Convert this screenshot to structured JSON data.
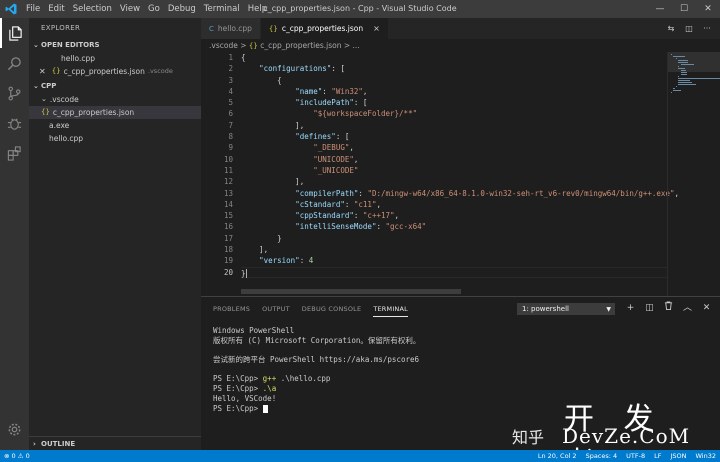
{
  "window": {
    "title": "c_cpp_properties.json - Cpp - Visual Studio Code",
    "menu": [
      "File",
      "Edit",
      "Selection",
      "View",
      "Go",
      "Debug",
      "Terminal",
      "Help"
    ],
    "controls": {
      "minimize": "—",
      "maximize": "☐",
      "close": "✕"
    }
  },
  "activity": {
    "icons": [
      "files-icon",
      "search-icon",
      "source-control-icon",
      "debug-icon",
      "extensions-icon"
    ],
    "settings_icon": "gear-icon"
  },
  "sidebar": {
    "title": "EXPLORER",
    "open_editors": {
      "label": "OPEN EDITORS",
      "items": [
        {
          "name": "hello.cpp",
          "dim": ""
        },
        {
          "name": "c_cpp_properties.json",
          "dim": ".vscode"
        }
      ]
    },
    "project": {
      "label": "CPP",
      "folder": ".vscode",
      "items": [
        {
          "name": "c_cpp_properties.json"
        },
        {
          "name": "a.exe"
        },
        {
          "name": "hello.cpp"
        }
      ]
    },
    "outline_label": "OUTLINE"
  },
  "tabs": [
    {
      "label": "hello.cpp",
      "active": false
    },
    {
      "label": "c_cpp_properties.json",
      "active": true,
      "close": "×"
    }
  ],
  "breadcrumb": {
    "folder": ".vscode",
    "sep": ">",
    "file": "c_cpp_properties.json",
    "tail": "> ..."
  },
  "editor": {
    "current_line": 20,
    "lines": [
      "{",
      "    \"configurations\": [",
      "        {",
      "            \"name\": \"Win32\",",
      "            \"includePath\": [",
      "                \"${workspaceFolder}/**\"",
      "            ],",
      "            \"defines\": [",
      "                \"_DEBUG\",",
      "                \"UNICODE\",",
      "                \"_UNICODE\"",
      "            ],",
      "            \"compilerPath\": \"D:/mingw-w64/x86_64-8.1.0-win32-seh-rt_v6-rev0/mingw64/bin/g++.exe\",",
      "            \"cStandard\": \"c11\",",
      "            \"cppStandard\": \"c++17\",",
      "            \"intelliSenseMode\": \"gcc-x64\"",
      "        }",
      "    ],",
      "    \"version\": 4",
      "}"
    ]
  },
  "panel": {
    "tabs": [
      "PROBLEMS",
      "OUTPUT",
      "DEBUG CONSOLE",
      "TERMINAL"
    ],
    "active_tab": "TERMINAL",
    "terminal_select": "1: powershell",
    "actions": {
      "add": "+",
      "split": "◫",
      "trash": "🗑",
      "maximize": "︿",
      "close": "✕"
    },
    "terminal_lines": [
      {
        "text": "Windows PowerShell"
      },
      {
        "text": "版权所有 (C) Microsoft Corporation。保留所有权利。"
      },
      {
        "text": ""
      },
      {
        "text": "尝试新的跨平台 PowerShell https://aka.ms/pscore6"
      },
      {
        "text": ""
      },
      {
        "prompt": "PS E:\\Cpp> ",
        "cmd": "g++",
        "rest": " .\\hello.cpp"
      },
      {
        "prompt": "PS E:\\Cpp> ",
        "cmd": ".\\a",
        "rest": ""
      },
      {
        "text": "Hello, VSCode!"
      },
      {
        "prompt": "PS E:\\Cpp> ",
        "cmd": "",
        "rest": "",
        "cursor": true
      }
    ]
  },
  "watermark": {
    "zh": "知乎",
    "top": "开 发 者",
    "bottom": "DevZe.CoM"
  },
  "status": {
    "left": "⊗ 0  ⚠ 0",
    "right": [
      "Ln 20, Col 2",
      "Spaces: 4",
      "UTF-8",
      "LF",
      "JSON",
      "Win32"
    ]
  },
  "colors": {
    "statusbar": "#007acc",
    "activity": "#333333",
    "sidebar": "#252526",
    "editor": "#1e1e1e"
  }
}
